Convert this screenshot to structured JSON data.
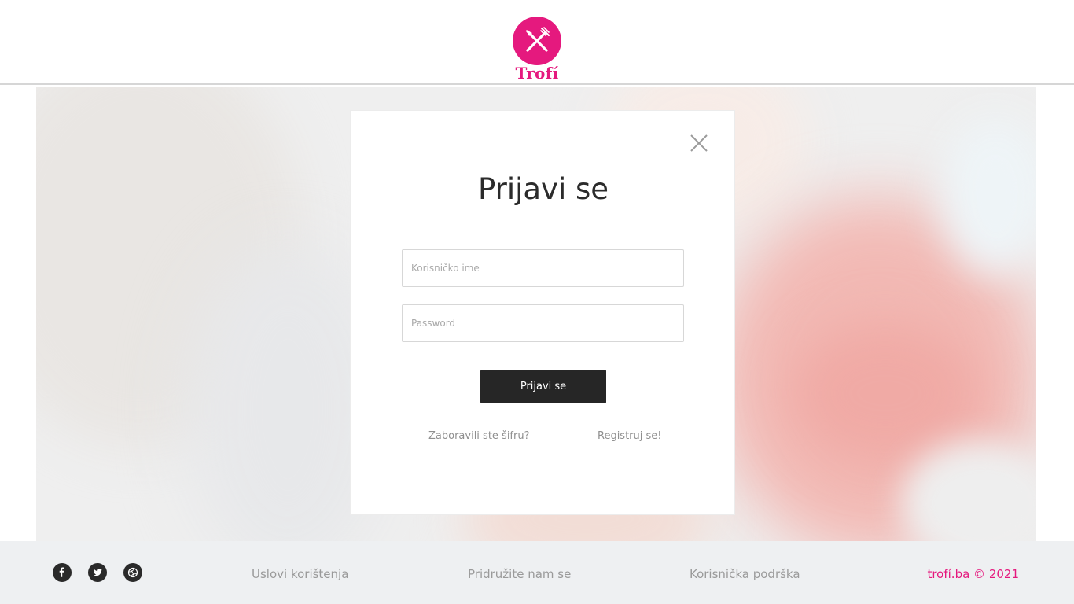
{
  "header": {
    "brand": "Trofí",
    "brand_color": "#e5197e",
    "logo_icon": "fork-knife-icon"
  },
  "login_modal": {
    "title": "Prijavi se",
    "username_placeholder": "Korisničko ime",
    "password_placeholder": "Password",
    "submit_label": "Prijavi se",
    "forgot_password_link": "Zaboravili ste šifru?",
    "register_link": "Registruj se!",
    "close_icon": "close-icon"
  },
  "footer": {
    "social": [
      "facebook-icon",
      "twitter-icon",
      "dribbble-icon"
    ],
    "links": [
      "Uslovi korištenja",
      "Pridružite nam se",
      "Korisnička podrška"
    ],
    "copyright": "trofí.ba © 2021"
  }
}
